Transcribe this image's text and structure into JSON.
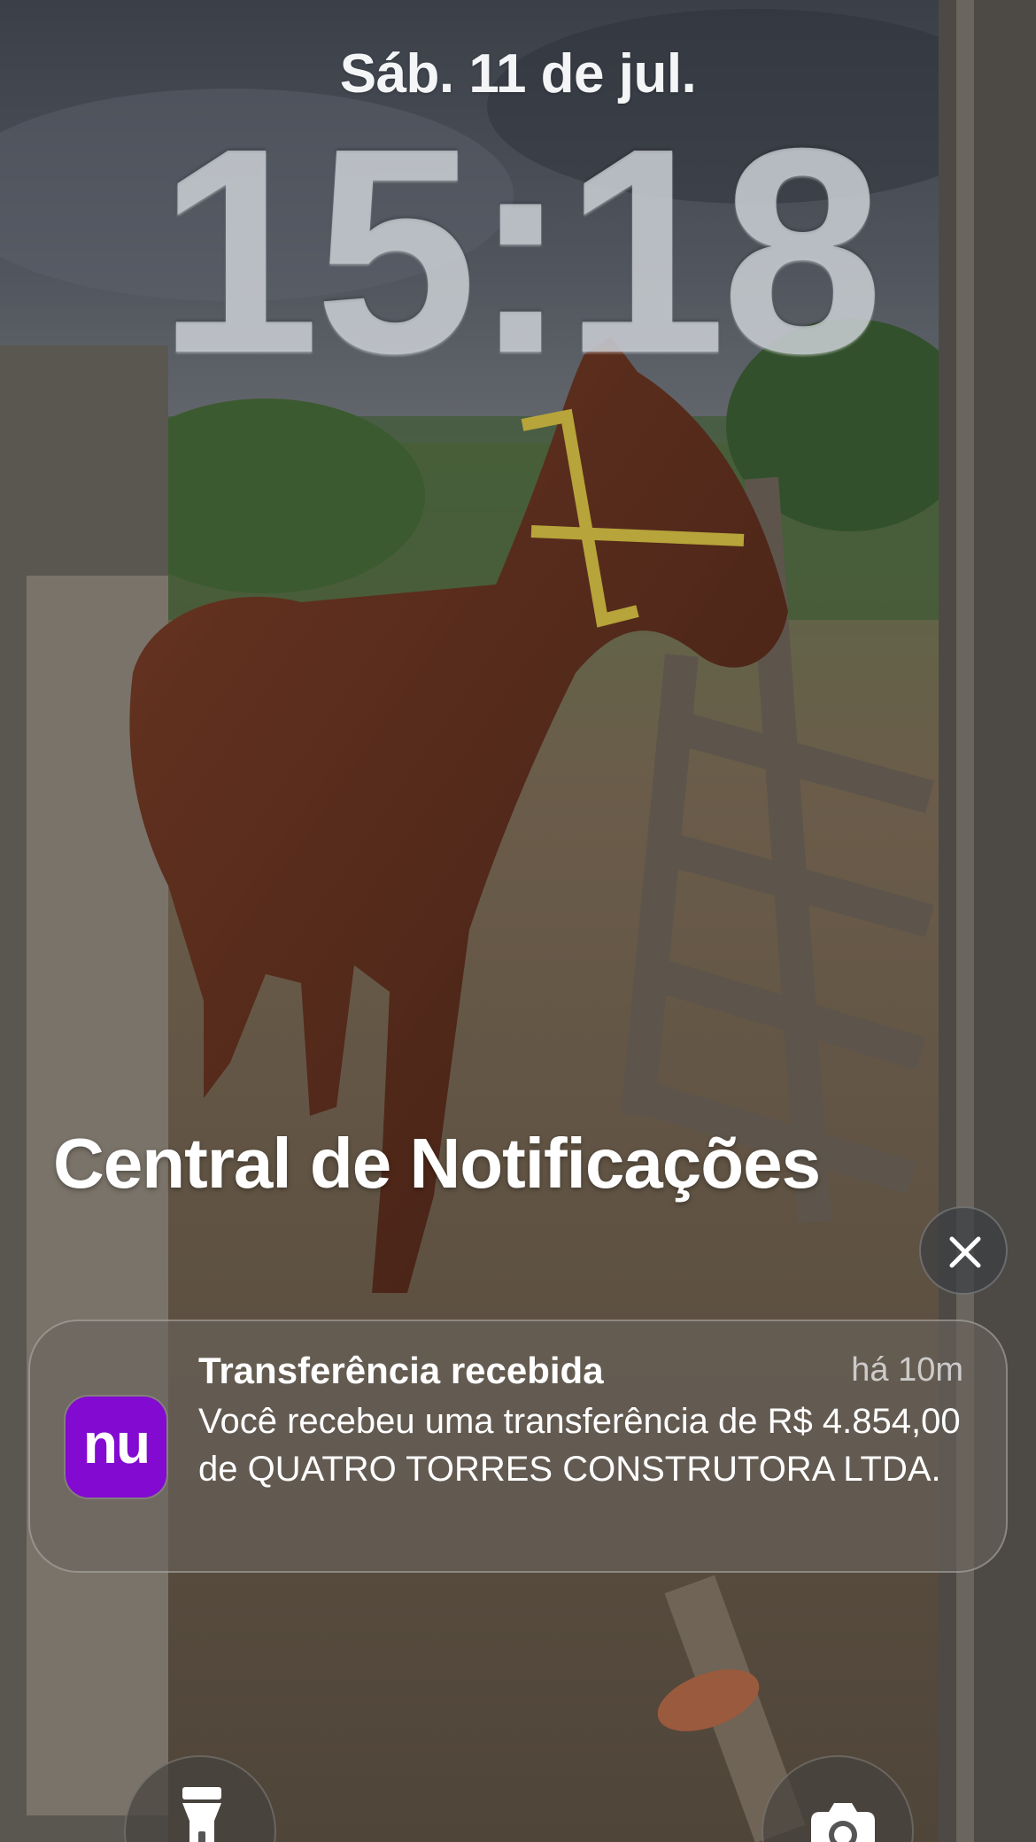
{
  "lock_screen": {
    "date": "Sáb. 11 de jul.",
    "time": "15:18"
  },
  "notification_center": {
    "title": "Central de Notificações",
    "clear_icon": "close-icon"
  },
  "notifications": [
    {
      "app_icon_text": "nu",
      "app_icon_color": "#820ad1",
      "title": "Transferência recebida",
      "time": "há 10m",
      "body": "Você recebeu uma transferência de R$ 4.854,00 de QUATRO TORRES CONSTRUTORA LTDA."
    }
  ],
  "quick_actions": {
    "left_icon": "flashlight-icon",
    "right_icon": "camera-icon"
  }
}
